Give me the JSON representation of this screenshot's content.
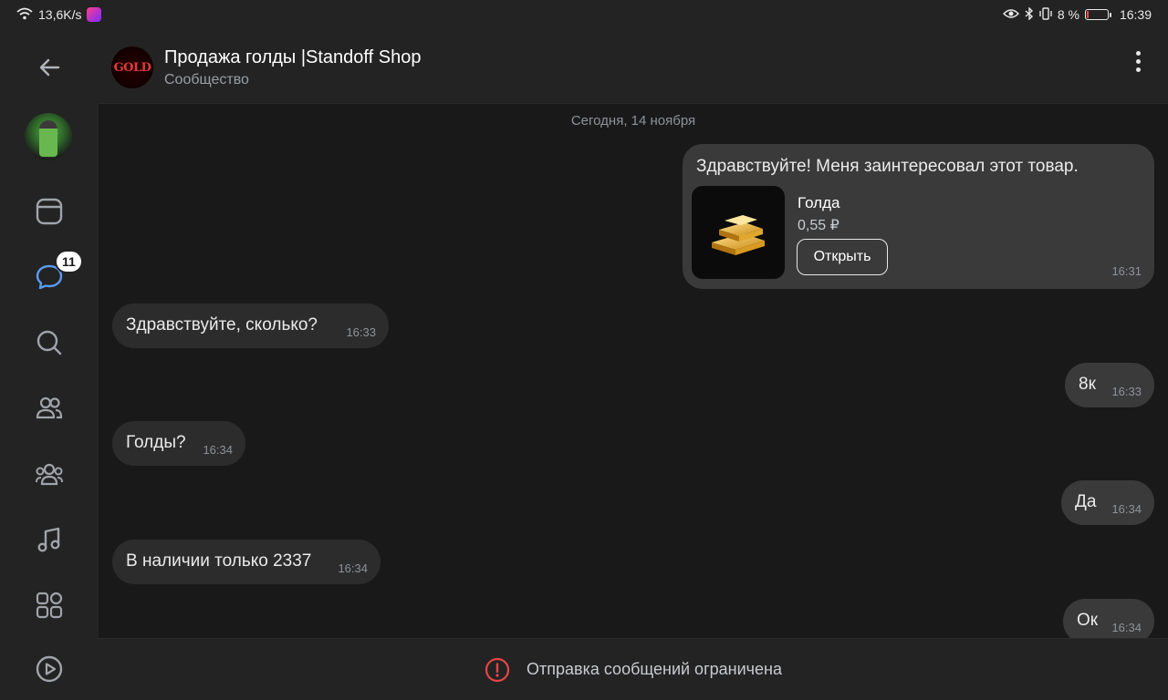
{
  "status_bar": {
    "net_speed": "13,6K/s",
    "battery": "8 %",
    "battery_level": 0.08,
    "time": "16:39"
  },
  "sidebar": {
    "badge_count": "11",
    "items": [
      "back-icon",
      "avatar",
      "news-icon",
      "messages-icon",
      "search-icon",
      "friends-icon",
      "communities-icon",
      "music-icon",
      "services-icon",
      "video-icon"
    ]
  },
  "header": {
    "title": "Продажа голды |Standoff Shop",
    "subtitle": "Сообщество",
    "avatar_text": "GOLD"
  },
  "chat": {
    "date": "Сегодня, 14 ноября",
    "product_message": {
      "text": "Здравствуйте! Меня заинтересовал этот товар.",
      "product_name": "Голда",
      "product_price": "0,55 ₽",
      "button_label": "Открыть",
      "time": "16:31"
    },
    "messages": [
      {
        "text": "Здравствуйте, сколько?",
        "time": "16:33",
        "side": "in"
      },
      {
        "text": "8к",
        "time": "16:33",
        "side": "out"
      },
      {
        "text": "Голды?",
        "time": "16:34",
        "side": "in"
      },
      {
        "text": "Да",
        "time": "16:34",
        "side": "out"
      },
      {
        "text": "В наличии только 2337",
        "time": "16:34",
        "side": "in"
      },
      {
        "text": "Ок",
        "time": "16:34",
        "side": "out"
      }
    ]
  },
  "footer": {
    "notice": "Отправка сообщений ограничена"
  },
  "colors": {
    "background": "#191919",
    "panel": "#232323",
    "bubble_in": "#2c2c2c",
    "bubble_out": "#3a3a3a",
    "warning": "#e64646",
    "accent_messages": "#5b9bf0"
  }
}
